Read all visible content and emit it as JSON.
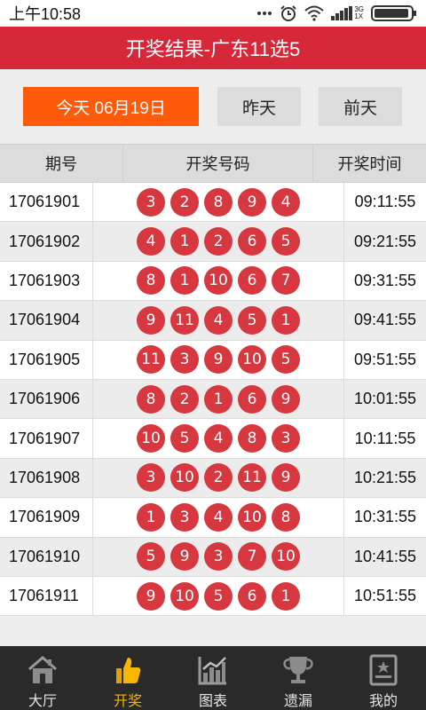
{
  "status": {
    "time": "上午10:58",
    "network": "3G",
    "network2": "1X"
  },
  "header": {
    "title": "开奖结果-广东11选5"
  },
  "days": {
    "today": "今天  06月19日",
    "yesterday": "昨天",
    "day_before": "前天"
  },
  "table": {
    "headers": [
      "期号",
      "开奖号码",
      "开奖时间"
    ],
    "rows": [
      {
        "issue": "17061901",
        "balls": [
          "3",
          "2",
          "8",
          "9",
          "4"
        ],
        "time": "09:11:55"
      },
      {
        "issue": "17061902",
        "balls": [
          "4",
          "1",
          "2",
          "6",
          "5"
        ],
        "time": "09:21:55"
      },
      {
        "issue": "17061903",
        "balls": [
          "8",
          "1",
          "10",
          "6",
          "7"
        ],
        "time": "09:31:55"
      },
      {
        "issue": "17061904",
        "balls": [
          "9",
          "11",
          "4",
          "5",
          "1"
        ],
        "time": "09:41:55"
      },
      {
        "issue": "17061905",
        "balls": [
          "11",
          "3",
          "9",
          "10",
          "5"
        ],
        "time": "09:51:55"
      },
      {
        "issue": "17061906",
        "balls": [
          "8",
          "2",
          "1",
          "6",
          "9"
        ],
        "time": "10:01:55"
      },
      {
        "issue": "17061907",
        "balls": [
          "10",
          "5",
          "4",
          "8",
          "3"
        ],
        "time": "10:11:55"
      },
      {
        "issue": "17061908",
        "balls": [
          "3",
          "10",
          "2",
          "11",
          "9"
        ],
        "time": "10:21:55"
      },
      {
        "issue": "17061909",
        "balls": [
          "1",
          "3",
          "4",
          "10",
          "8"
        ],
        "time": "10:31:55"
      },
      {
        "issue": "17061910",
        "balls": [
          "5",
          "9",
          "3",
          "7",
          "10"
        ],
        "time": "10:41:55"
      },
      {
        "issue": "17061911",
        "balls": [
          "9",
          "10",
          "5",
          "6",
          "1"
        ],
        "time": "10:51:55"
      }
    ]
  },
  "tabs": [
    {
      "label": "大厅",
      "icon": "house-icon",
      "active": false
    },
    {
      "label": "开奖",
      "icon": "thumbs-up-icon",
      "active": true
    },
    {
      "label": "图表",
      "icon": "chart-icon",
      "active": false
    },
    {
      "label": "遗漏",
      "icon": "trophy-icon",
      "active": false
    },
    {
      "label": "我的",
      "icon": "profile-card-icon",
      "active": false
    }
  ],
  "colors": {
    "header_red": "#d7283a",
    "today_orange": "#ff5a0a",
    "ball_red": "#d7373f",
    "tab_active": "#f5b700",
    "tabbar_bg": "#2a2a2a"
  }
}
